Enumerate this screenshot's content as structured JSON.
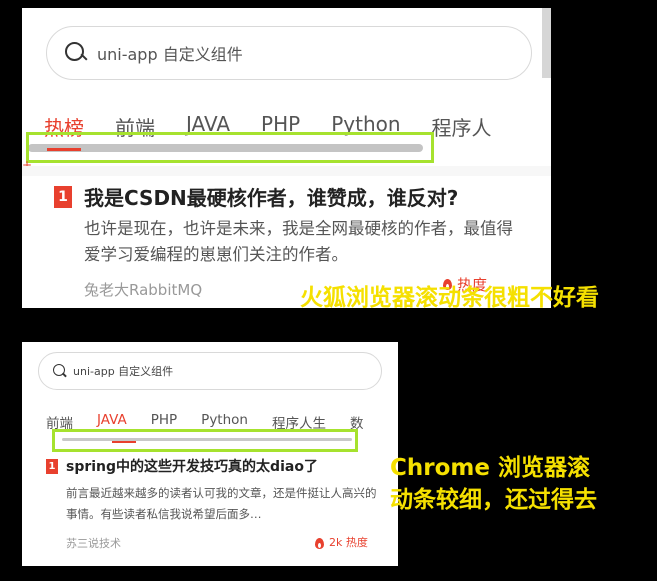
{
  "firefox_shot": {
    "search_placeholder": "uni-app 自定义组件",
    "tabs": [
      "热榜",
      "前端",
      "JAVA",
      "PHP",
      "Python",
      "程序人"
    ],
    "active_tab_index": 0,
    "article": {
      "rank": "1",
      "title": "我是CSDN最硬核作者，谁赞成，谁反对?",
      "description": "也许是现在，也许是未来，我是全网最硬核的作者，最值得爱学习爱编程的崽崽们关注的作者。",
      "author": "兔老大RabbitMQ",
      "hot": "热度"
    }
  },
  "chrome_shot": {
    "search_placeholder": "uni-app 自定义组件",
    "tabs": [
      "前端",
      "JAVA",
      "PHP",
      "Python",
      "程序人生",
      "数"
    ],
    "active_tab_index": 1,
    "article": {
      "rank": "1",
      "title": "spring中的这些开发技巧真的太diao了",
      "description": "前言最近越来越多的读者认可我的文章，还是件挺让人高兴的事情。有些读者私信我说希望后面多…",
      "author": "苏三说技术",
      "hot": "2k 热度"
    }
  },
  "annotations": {
    "firefox_note": "火狐浏览器滚动条很粗不好看",
    "chrome_note": "Chrome 浏览器滚动条较细，还过得去"
  },
  "colors": {
    "accent": "#e8402e",
    "highlight_box": "#a6e22e",
    "note_text": "#f5e000",
    "background": "#000000"
  }
}
